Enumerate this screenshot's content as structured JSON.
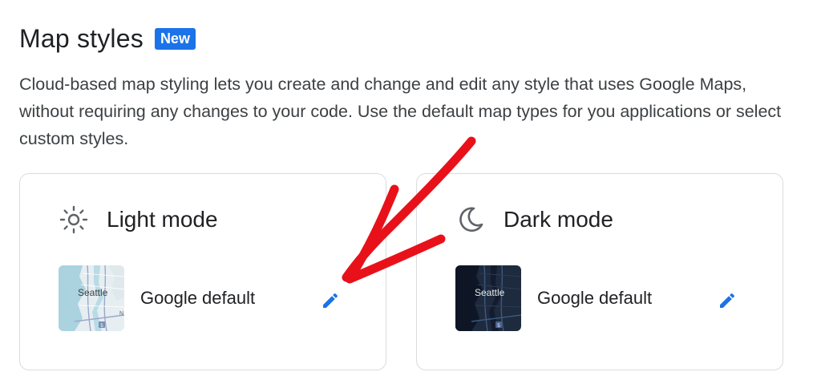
{
  "header": {
    "title": "Map styles",
    "badge": "New"
  },
  "description": "Cloud-based map styling lets you create and change and edit any style that uses Google Maps, without requiring any changes to your code. Use the default map types for you applications or select custom styles.",
  "cards": [
    {
      "mode_label": "Light mode",
      "icon": "sun-icon",
      "style_name": "Google default",
      "thumb_city": "Seattle",
      "thumb_shield": "5",
      "edit_icon": "pencil-icon"
    },
    {
      "mode_label": "Dark mode",
      "icon": "moon-icon",
      "style_name": "Google default",
      "thumb_city": "Seattle",
      "thumb_shield": "5",
      "edit_icon": "pencil-icon"
    }
  ],
  "colors": {
    "accent": "#1a73e8",
    "annotation": "#e8111a",
    "card_border": "#dadce0"
  }
}
